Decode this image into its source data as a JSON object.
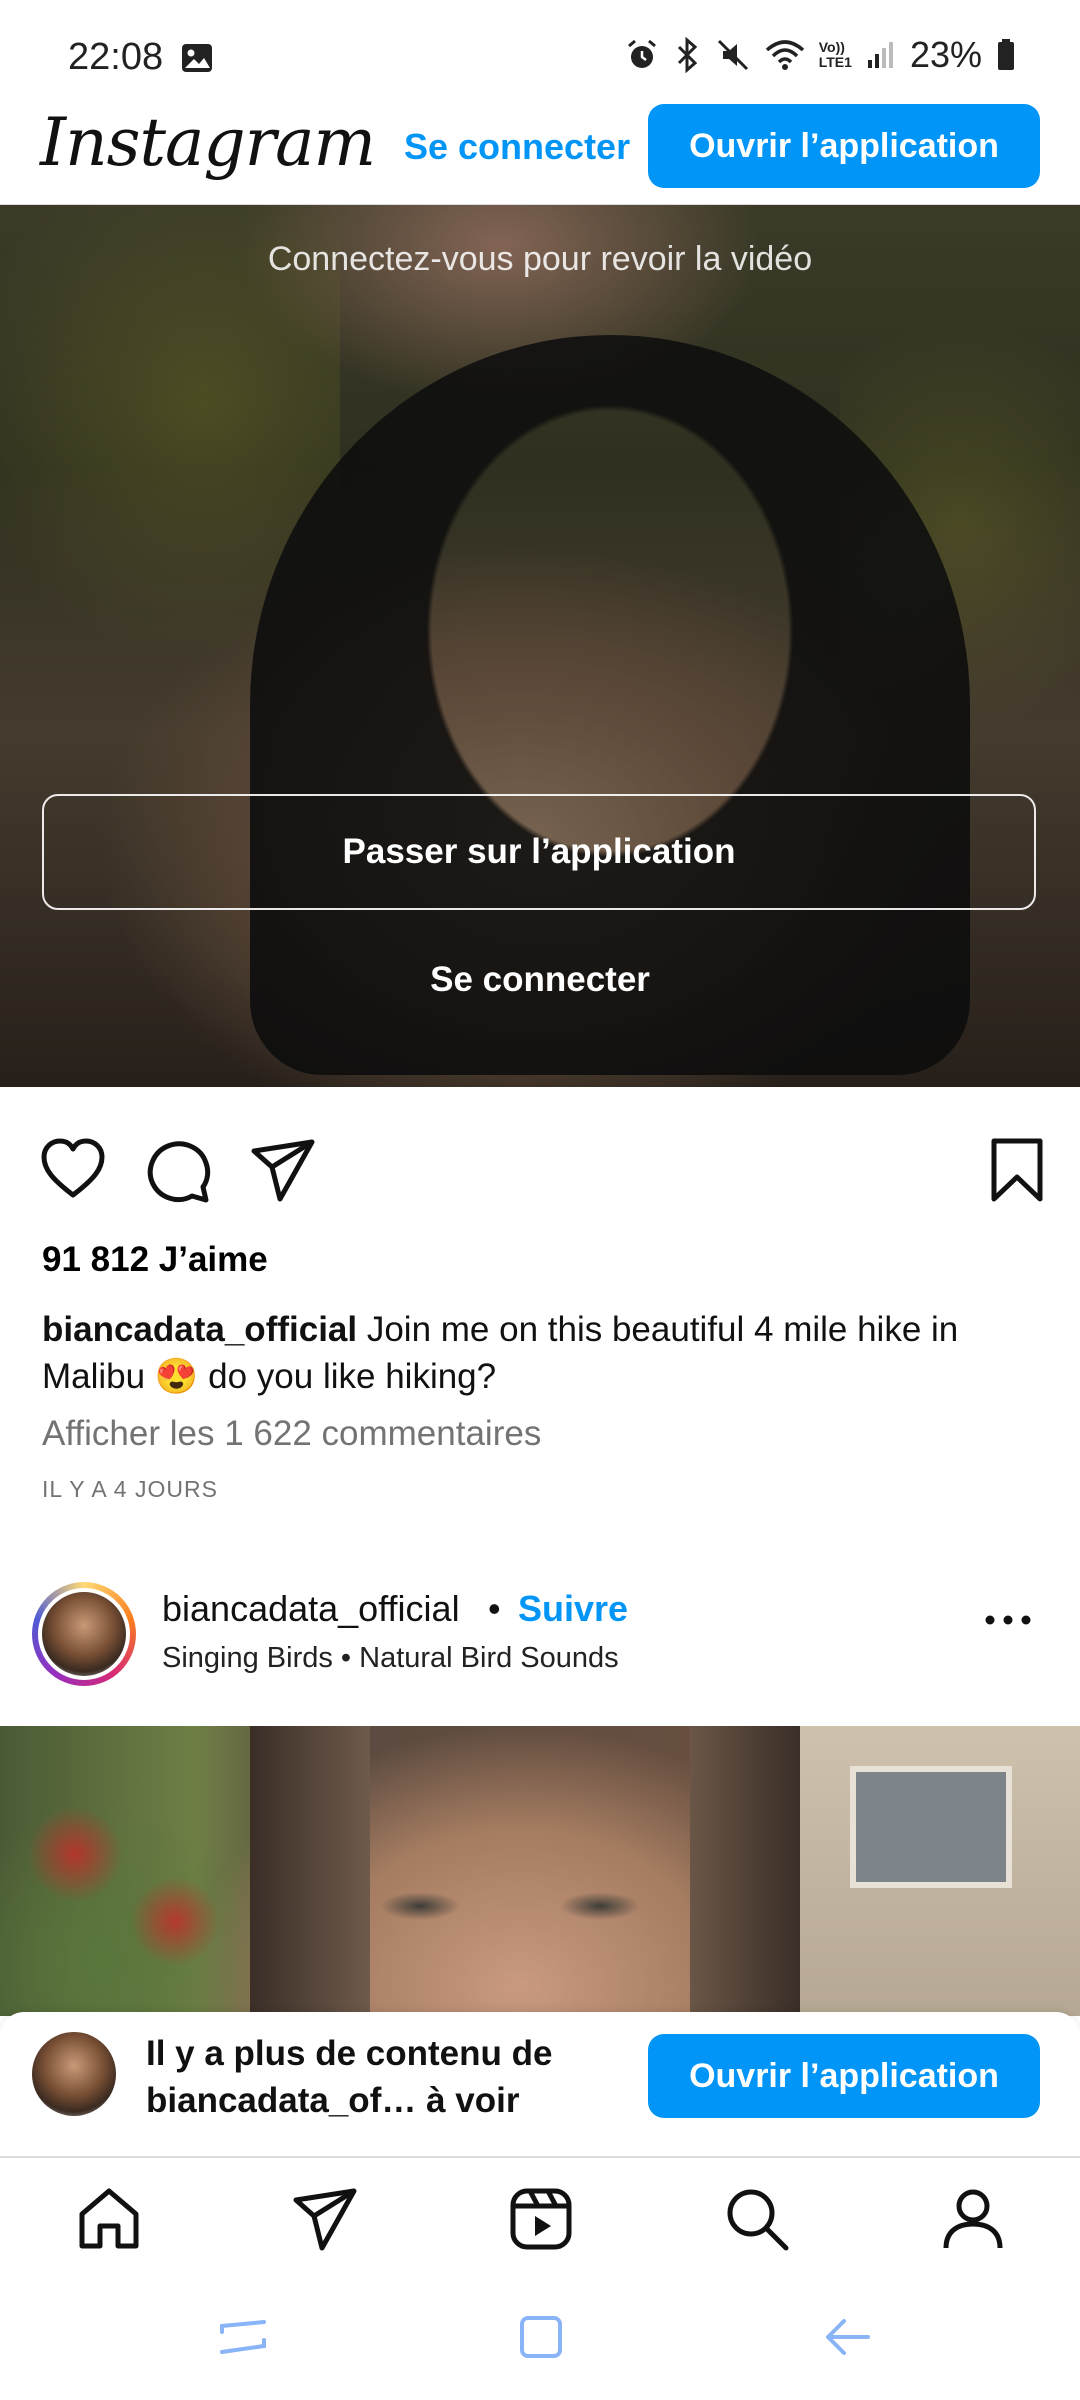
{
  "status_bar": {
    "time": "22:08",
    "vo_label": "Vo))",
    "lte_label": "LTE1",
    "battery": "23%",
    "icons": [
      "gallery-icon",
      "alarm-icon",
      "bluetooth-icon",
      "mute-icon",
      "wifi-icon",
      "signal-icon",
      "battery-icon"
    ]
  },
  "header": {
    "logo_text": "Instagram",
    "login_label": "Se connecter",
    "open_app_label": "Ouvrir l’application",
    "accent_color": "#0095f6"
  },
  "video_1": {
    "replay_hint": "Connectez-vous pour revoir la vidéo",
    "switch_app_label": "Passer sur l’application",
    "login_label": "Se connecter"
  },
  "post_1": {
    "likes": "91 812 J’aime",
    "username": "biancadata_official",
    "caption_part1": " Join me on this beautiful 4 mile hike in Malibu ",
    "caption_emoji": "😍",
    "caption_part2": " do you like hiking?",
    "view_comments": "Afficher les 1 622 commentaires",
    "date": "IL Y A 4 JOURS"
  },
  "post_2": {
    "username": "biancadata_official",
    "separator": "•",
    "follow_label": "Suivre",
    "music": "Singing Birds • Natural Bird Sounds"
  },
  "banner": {
    "text": "Il y a plus de contenu de biancadata_of… à voir",
    "open_app_label": "Ouvrir l’application"
  },
  "bottom_nav": {
    "items": [
      "home-icon",
      "direct-icon",
      "reels-icon",
      "search-icon",
      "profile-icon"
    ]
  },
  "system_nav": {
    "items": [
      "recents-icon",
      "home-icon",
      "back-icon"
    ]
  }
}
